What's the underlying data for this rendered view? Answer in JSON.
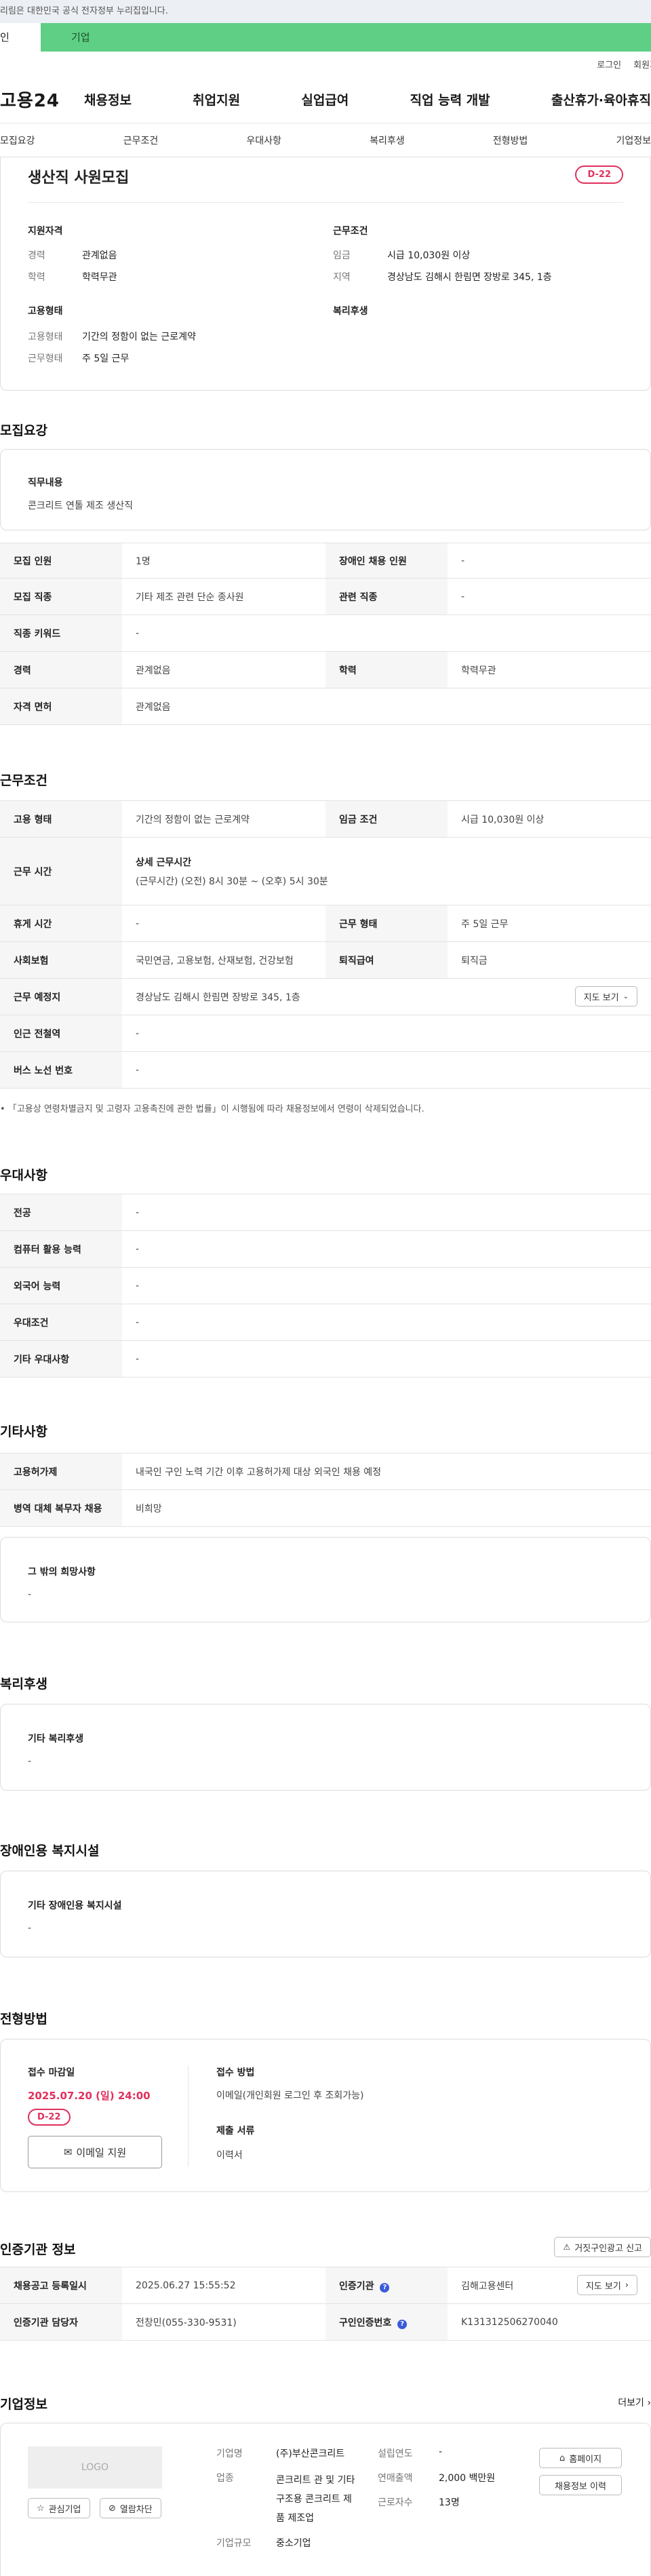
{
  "gov_banner": "리림은 대한민국 공식 전자정부 누리집입니다.",
  "tabs": {
    "personal": "인",
    "corporate": "기업"
  },
  "util": {
    "login": "로그인",
    "signup": "회원가"
  },
  "gnb": {
    "logo": "고용24",
    "items": [
      "채용정보",
      "취업지원",
      "실업급여",
      "직업 능력 개발",
      "출산휴가·육아휴직"
    ]
  },
  "subnav": [
    "모집요강",
    "근무조건",
    "우대사항",
    "복리후생",
    "전형방법",
    "기업정보"
  ],
  "summary": {
    "title": "생산직 사원모집",
    "dday": "D-22",
    "qual_title": "지원자격",
    "career_label": "경력",
    "career_value": "관계없음",
    "edu_label": "학력",
    "edu_value": "학력무관",
    "emp_title": "고용형태",
    "emptype_label": "고용형태",
    "emptype_value": "기간의 정함이 없는 근로계약",
    "workform_label": "근무형태",
    "workform_value": "주 5일 근무",
    "cond_title": "근무조건",
    "wage_label": "임금",
    "wage_value": "시급 10,030원 이상",
    "region_label": "지역",
    "region_value": "경상남도 김해시 한림면 장방로 345, 1층",
    "welfare_title": "복리후생"
  },
  "recruit": {
    "title": "모집요강",
    "job_title": "직무내용",
    "job_value": "콘크리트 연톨 제조 생산직",
    "rows": {
      "count_label": "모집 인원",
      "count_value": "1명",
      "disabled_label": "장애인 채용 인원",
      "disabled_value": "-",
      "occupation_label": "모집 직종",
      "occupation_value": "기타 제조 관련 단순 종사원",
      "related_label": "관련 직종",
      "related_value": "-",
      "keyword_label": "직종 키워드",
      "keyword_value": "-",
      "career_label": "경력",
      "career_value": "관계없음",
      "edu_label": "학력",
      "edu_value": "학력무관",
      "license_label": "자격 면허",
      "license_value": "관계없음"
    }
  },
  "conditions": {
    "title": "근무조건",
    "emptype_label": "고용 형태",
    "emptype_value": "기간의 정함이 없는 근로계약",
    "wage_label": "임금 조건",
    "wage_value": "시급 10,030원 이상",
    "hours_label": "근무 시간",
    "hours_sub": "상세 근무시간",
    "hours_value": "(근무시간) (오전) 8시 30분 ~ (오후) 5시 30분",
    "rest_label": "휴게 시간",
    "rest_value": "-",
    "workform_label": "근무 형태",
    "workform_value": "주 5일 근무",
    "insurance_label": "사회보험",
    "insurance_value": "국민연금, 고용보험, 산재보험, 건강보험",
    "severance_label": "퇴직급여",
    "severance_value": "퇴직금",
    "place_label": "근무 예정지",
    "place_value": "경상남도 김해시 한림면 장방로 345, 1층",
    "map_button": "지도 보기",
    "subway_label": "인근 전철역",
    "subway_value": "-",
    "bus_label": "버스 노선 번호",
    "bus_value": "-",
    "note": "「고용상 연령차별금지 및 고령자 고용촉진에 관한 법률」이 시행됨에 따라 채용정보에서 연령이 삭제되었습니다."
  },
  "preference": {
    "title": "우대사항",
    "rows": [
      {
        "label": "전공",
        "value": "-"
      },
      {
        "label": "컴퓨터 활용 능력",
        "value": "-"
      },
      {
        "label": "외국어 능력",
        "value": "-"
      },
      {
        "label": "우대조건",
        "value": "-"
      },
      {
        "label": "기타 우대사항",
        "value": "-"
      }
    ]
  },
  "etc": {
    "title": "기타사항",
    "rows": [
      {
        "label": "고용허가제",
        "value": "내국인 구인 노력 기간 이후 고용허가제 대상 외국인 채용 예정"
      },
      {
        "label": "병역 대체 복무자 채용",
        "value": "비희망"
      }
    ],
    "other_title": "그 밖의 희망사항",
    "other_value": "-"
  },
  "welfare": {
    "title": "복리후생",
    "box_title": "기타 복리후생",
    "box_value": "-"
  },
  "disabled_fac": {
    "title": "장애인용 복지시설",
    "box_title": "기타 장애인용 복지시설",
    "box_value": "-"
  },
  "apply": {
    "title": "전형방법",
    "deadline_label": "접수 마감일",
    "deadline_value": "2025.07.20 (일) 24:00",
    "dday": "D-22",
    "email_button": "이메일 지원",
    "method_label": "접수 방법",
    "method_value": "이메일(개인회원 로그인 후 조회가능)",
    "docs_label": "제출 서류",
    "docs_value": "이력서"
  },
  "cert": {
    "title": "인증기관 정보",
    "report_button": "거짓구인광고 신고",
    "regdate_label": "채용공고 등록일시",
    "regdate_value": "2025.06.27 15:55:52",
    "agency_label": "인증기관",
    "agency_value": "김해고용센터",
    "map_button": "지도 보기",
    "manager_label": "인증기관 담당자",
    "manager_value": "전창민(055-330-9531)",
    "certno_label": "구인인증번호",
    "certno_value": "K131312506270040"
  },
  "company": {
    "title": "기업정보",
    "more": "더보기",
    "logo_text": "LOGO",
    "interest_button": "관심기업",
    "block_button": "열람차단",
    "name_label": "기업명",
    "name_value": "(주)부산콘크리트",
    "industry_label": "업종",
    "industry_value": "콘크리트 관 및 기타 구조용 콘크리트 제품 제조업",
    "size_label": "기업규모",
    "size_value": "중소기업",
    "founded_label": "설립연도",
    "founded_value": "-",
    "sales_label": "연매출액",
    "sales_value": "2,000 백만원",
    "staff_label": "근로자수",
    "staff_value": "13명",
    "home_button": "홈페이지",
    "history_button": "채용정보 이력"
  },
  "colors": {
    "accent_green": "#5ecf84",
    "dday_red": "#e0305d",
    "info_blue": "#3b5bdb"
  }
}
